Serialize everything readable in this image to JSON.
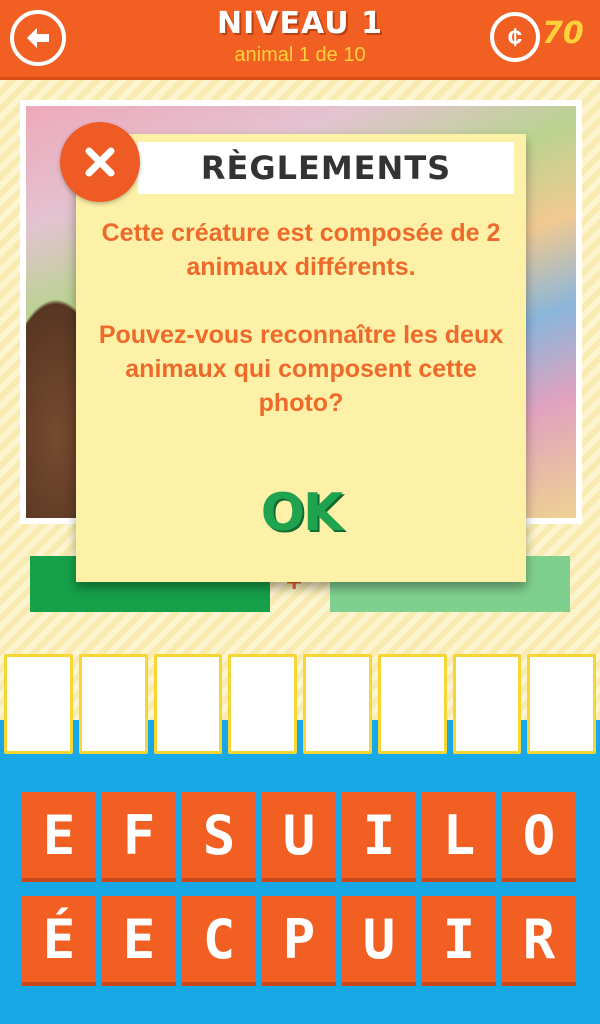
{
  "header": {
    "title": "NIVEAU 1",
    "subtitle": "animal 1 de 10",
    "coin_symbol": "¢",
    "coin_count": "70"
  },
  "colors": {
    "orange": "#f25f22",
    "yellow": "#ffd23c",
    "green": "#16a04a",
    "light_green": "#7fd08f",
    "blue": "#18a8e8"
  },
  "answer": {
    "plus": "+"
  },
  "slots_count": 8,
  "keyboard": {
    "row1": [
      "E",
      "F",
      "S",
      "U",
      "I",
      "L",
      "O"
    ],
    "row2": [
      "É",
      "E",
      "C",
      "P",
      "U",
      "I",
      "R"
    ]
  },
  "modal": {
    "title": "RÈGLEMENTS",
    "paragraph1": "Cette créature est composée de 2 animaux différents.",
    "paragraph2": "Pouvez-vous reconnaître les deux animaux qui composent cette photo?",
    "ok_label": "OK"
  },
  "icons": {
    "back": "back-arrow-icon",
    "close": "close-icon",
    "coin": "coin-icon"
  }
}
